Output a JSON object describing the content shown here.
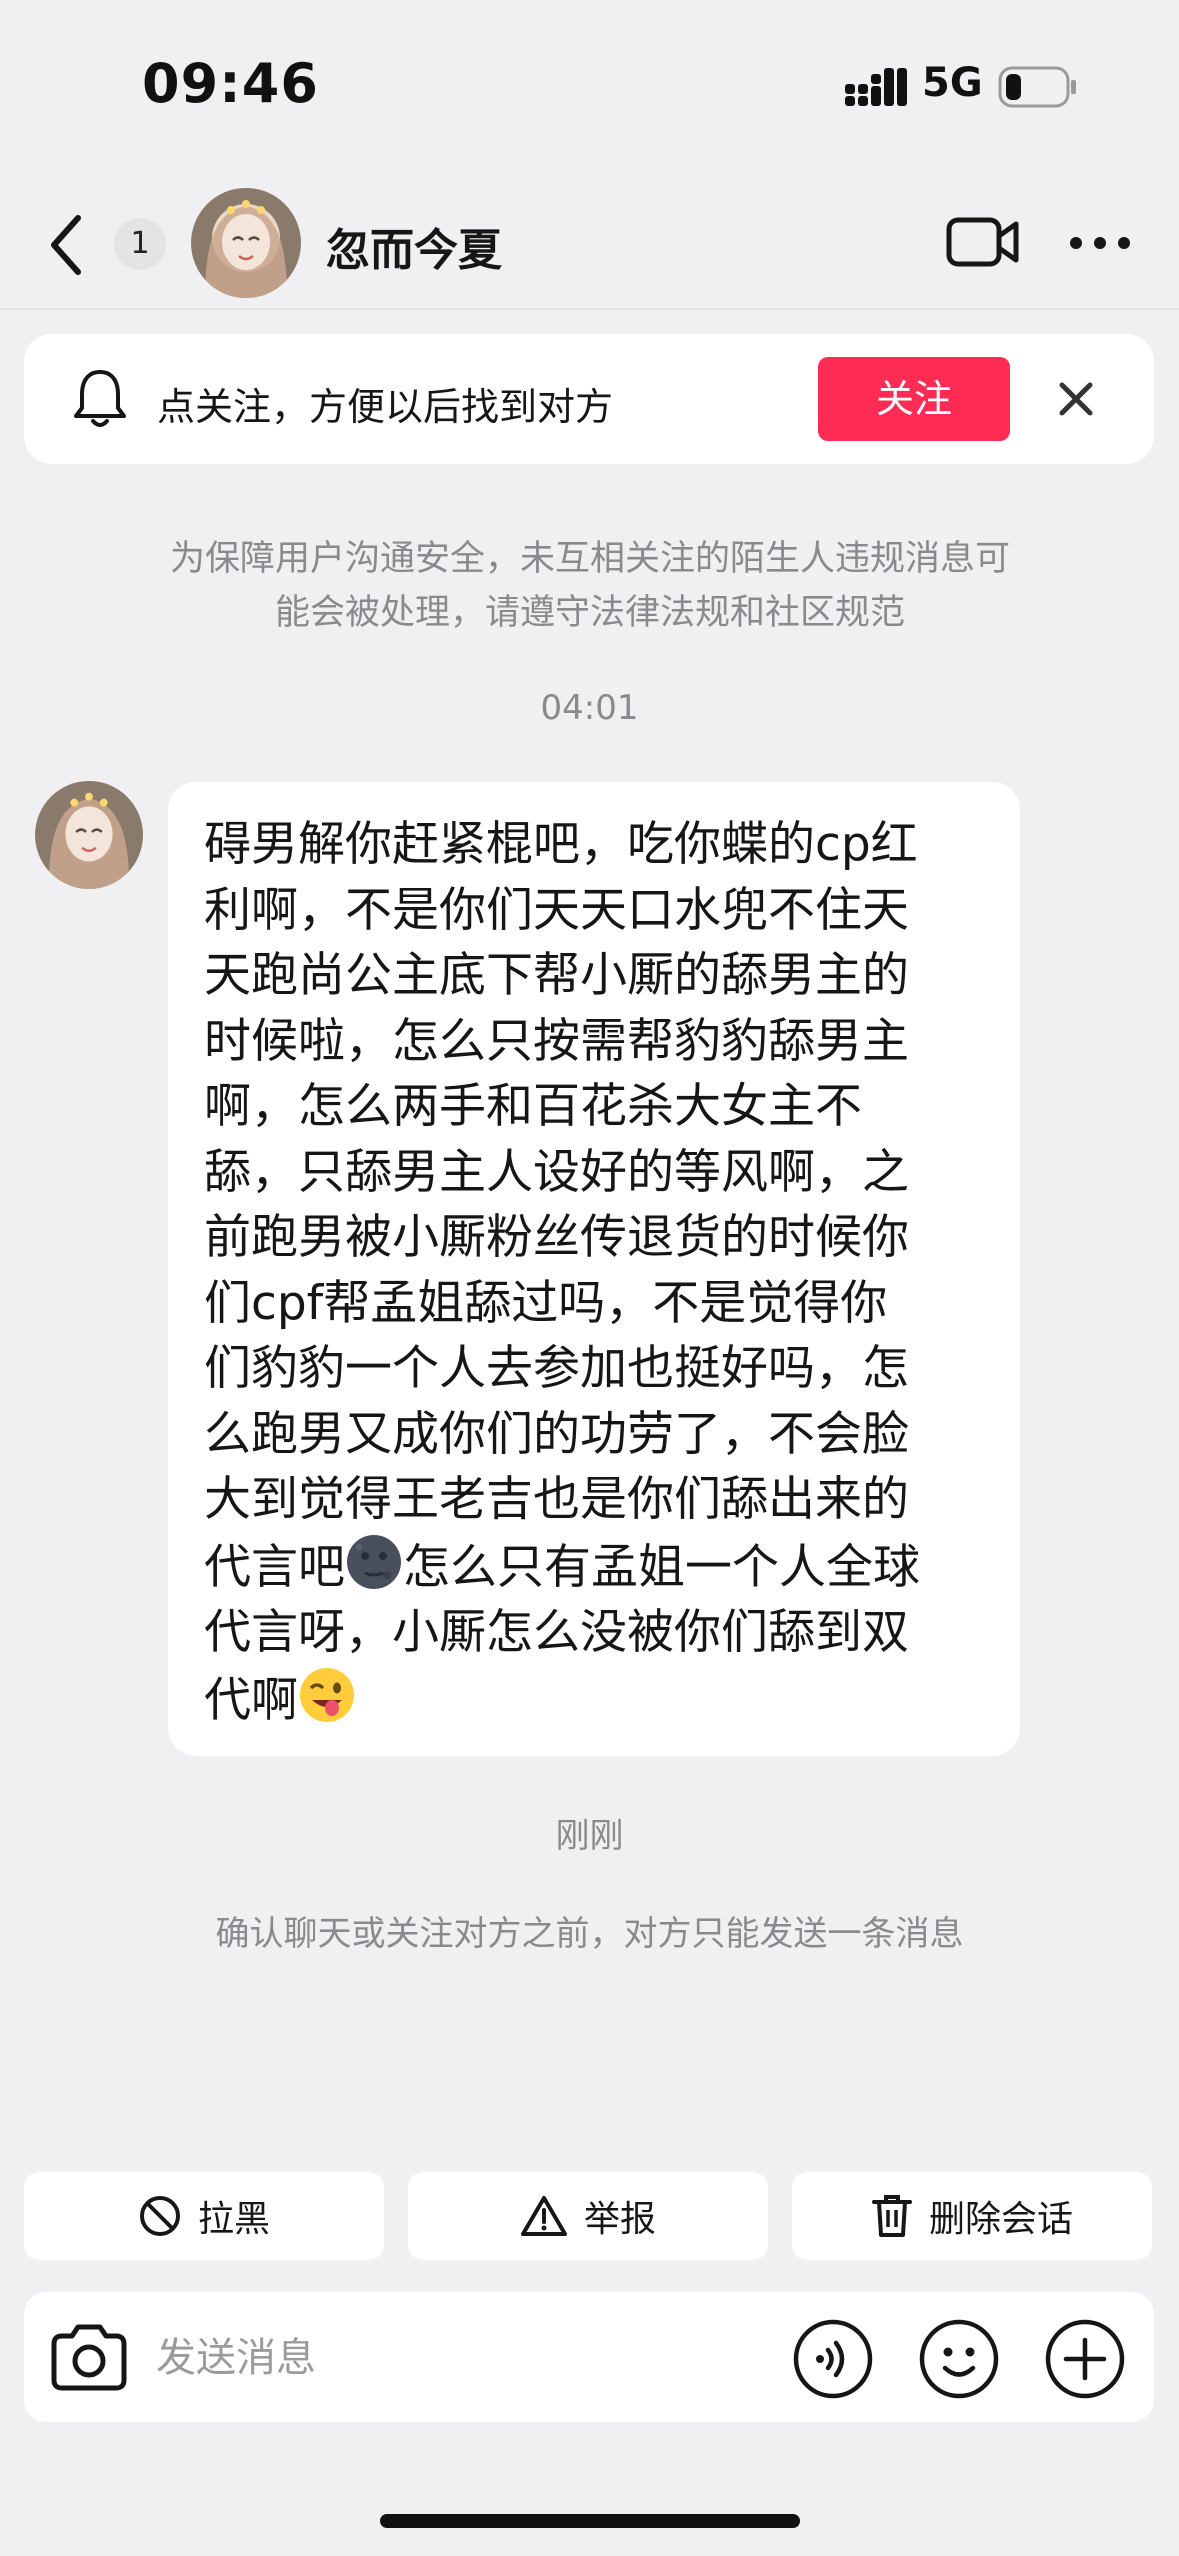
{
  "status_bar": {
    "time": "09:46",
    "network": "5G"
  },
  "nav": {
    "badge": "1",
    "title": "忽而今夏"
  },
  "banner": {
    "text": "点关注，方便以后找到对方",
    "follow_label": "关注",
    "accent": "#fe2c55"
  },
  "notice": {
    "line1": "为保障用户沟通安全，未互相关注的陌生人违规消息可",
    "line2": "能会被处理，请遵守法律法规和社区规范"
  },
  "time_top": "04:01",
  "message": {
    "lines": [
      "碍男解你赶紧棍吧，吃你蝶的cp红",
      "利啊，不是你们天天口水兜不住天",
      "天跑尚公主底下帮小厮的舔男主的",
      "时候啦，怎么只按需帮豹豹舔男主",
      "啊，怎么两手和百花杀大女主不",
      "舔，只舔男主人设好的等风啊，之",
      "前跑男被小厮粉丝传退货的时候你",
      "们cpf帮孟姐舔过吗，不是觉得你",
      "们豹豹一个人去参加也挺好吗，怎",
      "么跑男又成你们的功劳了，不会脸",
      "大到觉得王老吉也是你们舔出来的"
    ],
    "line12_a": "代言吧",
    "line12_b": "怎么只有孟姐一个人全球",
    "line13": "代言呀，小厮怎么没被你们舔到双",
    "line14": "代啊",
    "emoji_1": "new-moon-face-emoji",
    "emoji_2": "winking-face-with-tongue-emoji"
  },
  "time_bottom": "刚刚",
  "limit_notice": "确认聊天或关注对方之前，对方只能发送一条消息",
  "actions": {
    "block": "拉黑",
    "report": "举报",
    "delete": "删除会话"
  },
  "composer": {
    "placeholder": "发送消息"
  }
}
